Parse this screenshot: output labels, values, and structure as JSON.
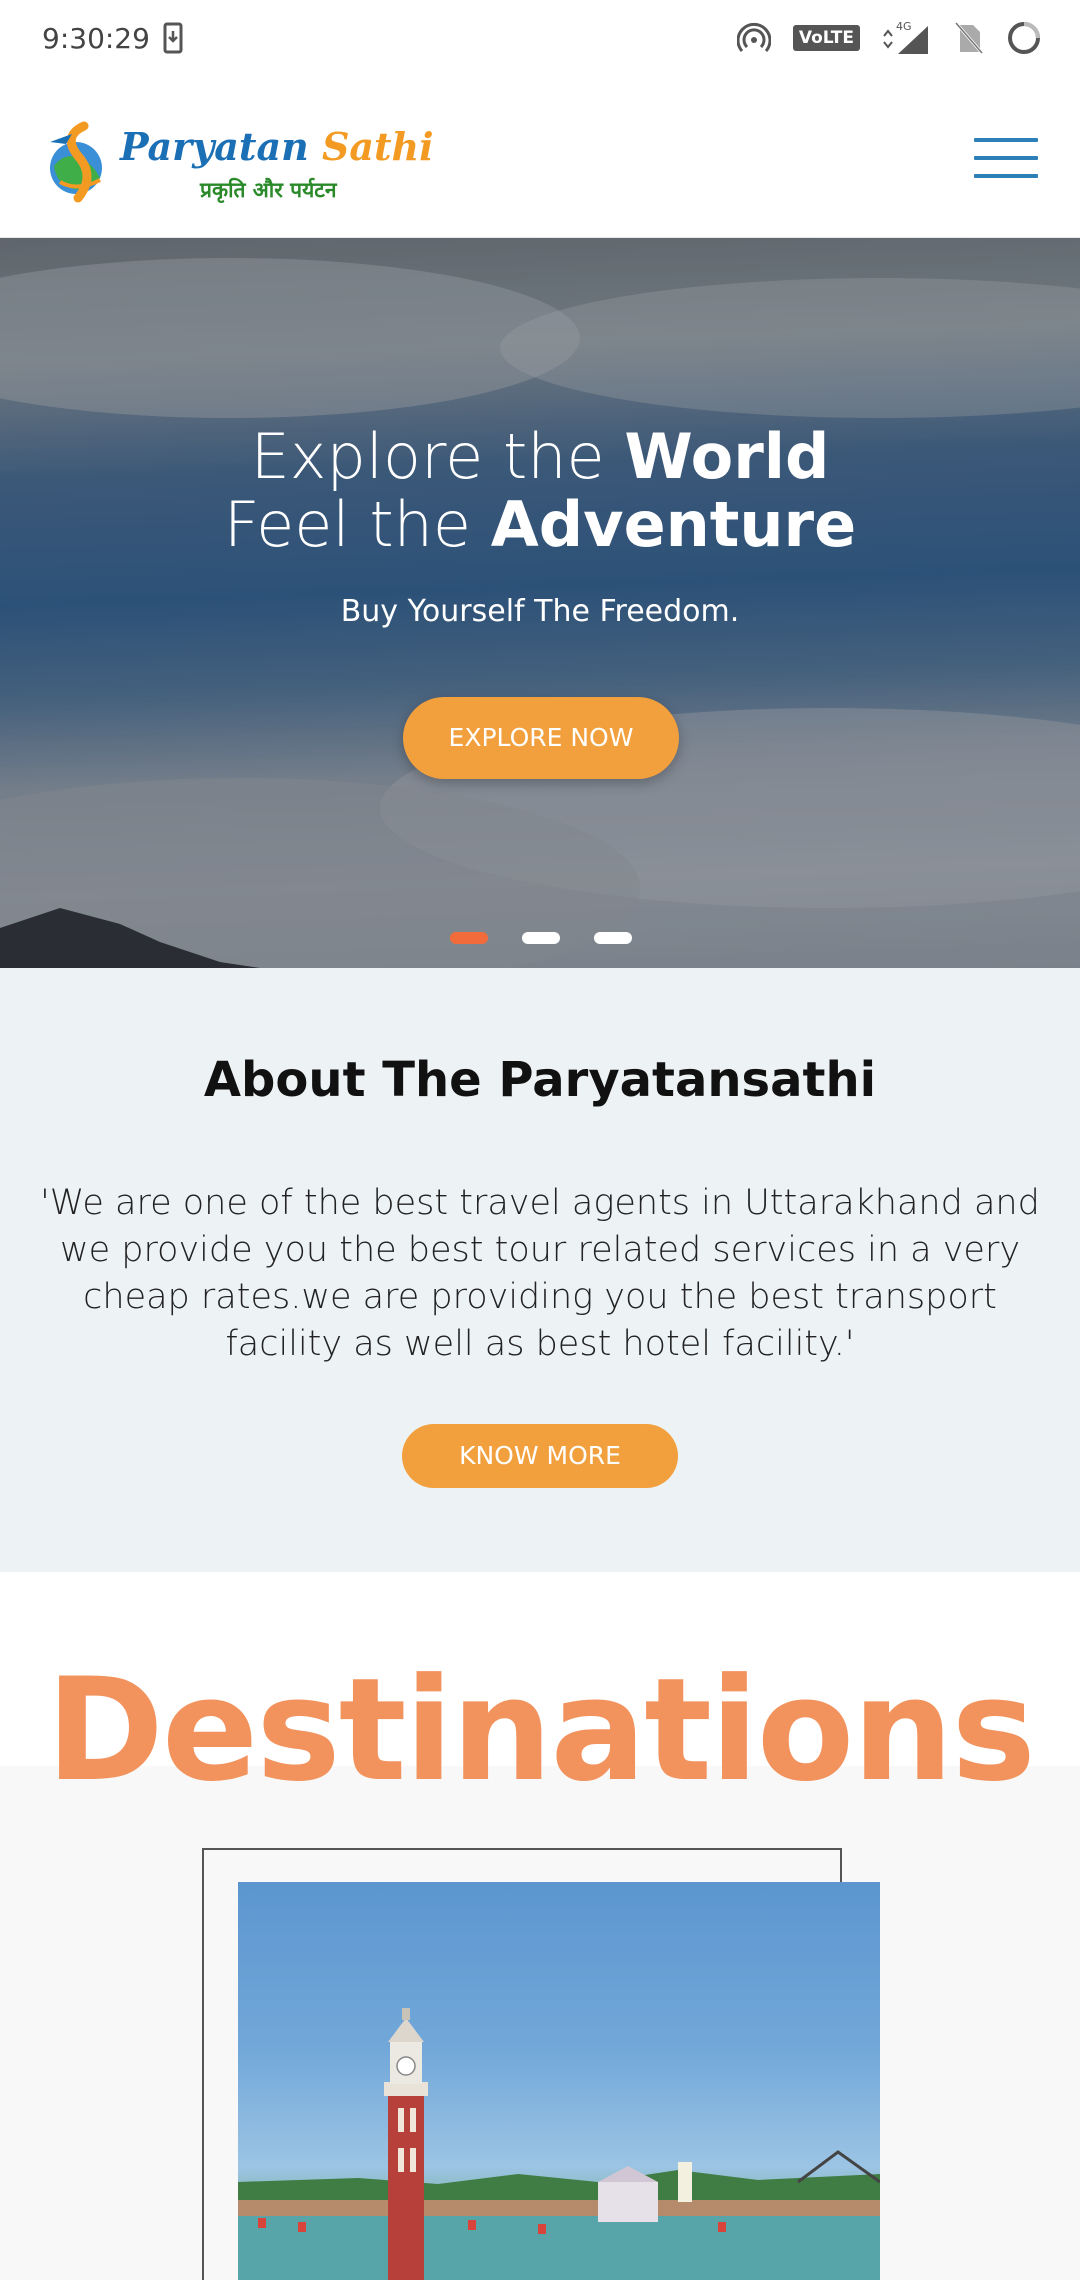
{
  "status_bar": {
    "time": "9:30:29",
    "network": "4G",
    "volte": "VoLTE",
    "icons": [
      "hotspot-icon",
      "volte-icon",
      "signal-icon",
      "no-sim-icon",
      "loading-icon"
    ]
  },
  "header": {
    "logo_name_part1": "Paryatan",
    "logo_name_part2": "Sathi",
    "logo_tagline": "प्रकृति और पर्यटन",
    "menu_icon": "hamburger-menu-icon"
  },
  "hero": {
    "line1_light": "Explore the",
    "line1_bold": "World",
    "line2_light": "Feel the",
    "line2_bold": "Adventure",
    "subtitle": "Buy Yourself The Freedom.",
    "button_label": "EXPLORE NOW",
    "active_slide": 1,
    "slide_count": 3
  },
  "about": {
    "title": "About The Paryatansathi",
    "text": "'We are one of the best travel agents in Uttarakhand and we provide you the best tour related services in a very cheap rates.we are providing you the best transport facility as well as best hotel facility.'",
    "button_label": "KNOW MORE"
  },
  "destinations": {
    "title": "Destinations"
  },
  "colors": {
    "accent_orange": "#f2a03d",
    "active_dot": "#f26b3a",
    "destinations_title": "#f2935e",
    "menu_blue": "#2d7fb8"
  }
}
